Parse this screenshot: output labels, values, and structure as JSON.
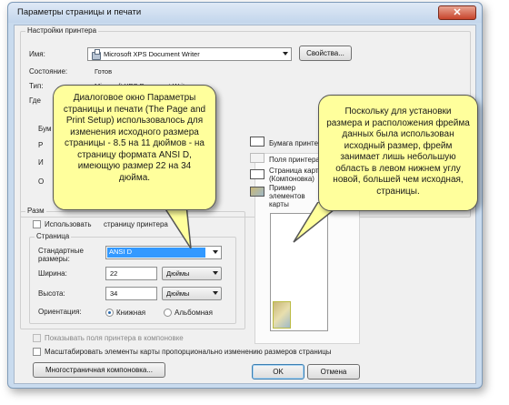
{
  "window": {
    "title": "Параметры страницы и печати",
    "close_glyph": "✕"
  },
  "printer_group": {
    "title": "Настройки принтера",
    "name_label": "Имя:",
    "name_value": "Microsoft XPS Document Writer",
    "properties_button": "Свойства...",
    "status_label": "Состояние:",
    "status_value": "Готов",
    "type_label": "Тип:",
    "type_value": "Microsoft XPS Document Writer",
    "where_label": "Где",
    "partial_labels": [
      "Бум",
      "Р",
      "И",
      "О"
    ]
  },
  "map_group": {
    "title": "Разм",
    "use_printer_checkbox": "Использовать",
    "use_printer_checkbox_tail": "страницу принтера",
    "page_title": "Страница",
    "standard_sizes_label": "Стандартные размеры:",
    "standard_sizes_value": "ANSI D",
    "width_label": "Ширина:",
    "width_value": "22",
    "width_unit": "Дюймы",
    "height_label": "Высота:",
    "height_value": "34",
    "height_unit": "Дюймы",
    "orientation_label": "Ориентация:",
    "portrait": "Книжная",
    "landscape": "Альбомная"
  },
  "legend": {
    "paper": "Бумага принтера",
    "printer_margins": "Поля принтера",
    "map_page": "Страница карты (Компоновка)",
    "map_element": "Пример элементов карты"
  },
  "options": {
    "show_margins": "Показывать поля принтера в компоновке",
    "scale_elements": "Масштабировать элементы карты пропорционально изменению размеров страницы"
  },
  "buttons": {
    "multipage": "Многостраничная компоновка...",
    "ok": "OK",
    "cancel": "Отмена"
  },
  "callouts": {
    "left": "Диалоговое окно Параметры страницы и печати (The Page and Print Setup) использовалось для изменения исходного размера страницы - 8.5 на 11 дюймов - на страницу формата ANSI D, имеющую размер 22 на 34 дюйма.",
    "right": "Поскольку для установки размера и расположения фрейма данных была использован исходный размер, фрейм занимает лишь небольшую область в левом нижнем углу новой, большей чем исходная, страницы."
  },
  "colors": {
    "callout_fill": "#ffff9c",
    "selection": "#3399ff",
    "close_button": "#c7432b"
  }
}
